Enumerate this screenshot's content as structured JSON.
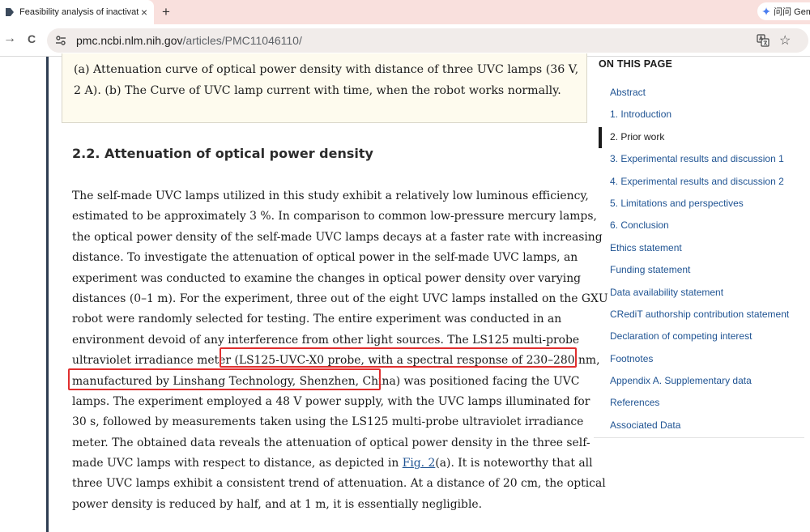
{
  "browser": {
    "tab_title": "Feasibility analysis of inactivation",
    "tab_close": "×",
    "new_tab": "+",
    "gemini_label": "问问 Gemini",
    "url_host": "pmc.ncbi.nlm.nih.gov",
    "url_path": "/articles/PMC11046110/",
    "back_glyph": "→",
    "reload_glyph": "C",
    "star_glyph": "☆"
  },
  "article": {
    "caption": "(a) Attenuation curve of optical power density with distance of three UVC lamps (36 V, 2 A). (b) The Curve of UVC lamp current with time, when the robot works normally.",
    "section_heading": "2.2. Attenuation of optical power density",
    "paragraph": {
      "line1": "The self-made UVC lamps utilized in this study exhibit a relatively low luminous efficiency,",
      "line2": "estimated to be approximately 3 %. In comparison to common low-pressure mercury lamps,",
      "line3": "the optical power density of the self-made UVC lamps decays at a faster rate with increasing",
      "line4": "distance. To investigate the attenuation of optical power in the self-made UVC lamps, an",
      "line5": "experiment was conducted to examine the changes in optical power density over varying",
      "line6": "distances (0–1 m). For the experiment, three out of the eight UVC lamps installed on the GXU",
      "line7": "robot were randomly selected for testing. The entire experiment was conducted in an",
      "line8": "environment devoid of any interference from other light sources. The LS125 multi-probe",
      "line9": "ultraviolet irradiance meter (LS125-UVC-X0 probe, with a spectral response of 230–280 nm,",
      "line10": "manufactured by Linshang Technology, Shenzhen, China) was positioned facing the UVC",
      "line11": "lamps. The experiment employed a 48 V power supply, with the UVC lamps illuminated for",
      "line12": "30 s, followed by measurements taken using the LS125 multi-probe ultraviolet irradiance",
      "line13": "meter. The obtained data reveals the attenuation of optical power density in the three self-",
      "line14_pre": "made UVC lamps with respect to distance, as depicted in ",
      "line14_link": "Fig. 2",
      "line14_post": "(a). It is noteworthy that all",
      "line15": "three UVC lamps exhibit a consistent trend of attenuation. At a distance of 20 cm, the optical",
      "line16": "power density is reduced by half, and at 1 m, it is essentially negligible."
    }
  },
  "toc": {
    "heading": "ON THIS PAGE",
    "items": [
      "Abstract",
      "1. Introduction",
      "2. Prior work",
      "3. Experimental results and discussion 1",
      "4. Experimental results and discussion 2",
      "5. Limitations and perspectives",
      "6. Conclusion",
      "Ethics statement",
      "Funding statement",
      "Data availability statement",
      "CRediT authorship contribution statement",
      "Declaration of competing interest",
      "Footnotes",
      "Appendix A. Supplementary data",
      "References",
      "Associated Data"
    ],
    "active_index": 2
  },
  "colors": {
    "link": "#205493",
    "highlight_box": "#e02f2f",
    "caption_bg": "#fefbee",
    "tab_strip": "#f9e0dd"
  }
}
